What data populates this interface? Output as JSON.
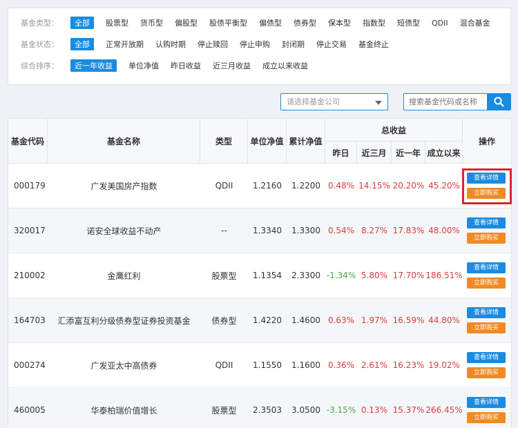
{
  "filters": {
    "type": {
      "label": "基金类型：",
      "options": [
        "全部",
        "股票型",
        "货币型",
        "偏股型",
        "股债平衡型",
        "偏债型",
        "债券型",
        "保本型",
        "指数型",
        "短债型",
        "QDII",
        "混合基金"
      ]
    },
    "status": {
      "label": "基金状态：",
      "options": [
        "全部",
        "正常开放期",
        "认购时期",
        "停止赎回",
        "停止申购",
        "封闭期",
        "停止交易",
        "基金终止"
      ]
    },
    "sort": {
      "label": "综合排序：",
      "options": [
        "近一年收益",
        "单位净值",
        "昨日收益",
        "近三月收益",
        "成立以来收益"
      ]
    }
  },
  "search": {
    "company_placeholder": "请选择基金公司",
    "keyword_placeholder": "搜索基金代码或名称"
  },
  "table": {
    "headers": {
      "code": "基金代码",
      "name": "基金名称",
      "type": "类型",
      "nav": "单位净值",
      "acc_nav": "累计净值",
      "total_return": "总收益",
      "yesterday": "昨日",
      "three_month": "近三月",
      "one_year": "近一年",
      "since_inception": "成立以来",
      "actions": "操作"
    },
    "rows": [
      {
        "code": "000179",
        "name": "广发美国房产指数",
        "type": "QDII",
        "nav": "1.2160",
        "acc_nav": "1.2200",
        "yesterday": "0.48%",
        "three_month": "14.15%",
        "one_year": "20.20%",
        "since_inception": "45.20%"
      },
      {
        "code": "320017",
        "name": "诺安全球收益不动产",
        "type": "--",
        "nav": "1.3340",
        "acc_nav": "1.3300",
        "yesterday": "0.54%",
        "three_month": "8.27%",
        "one_year": "17.83%",
        "since_inception": "48.00%"
      },
      {
        "code": "210002",
        "name": "金鹰红利",
        "type": "股票型",
        "nav": "1.1354",
        "acc_nav": "2.3300",
        "yesterday": "-1.34%",
        "three_month": "5.80%",
        "one_year": "17.70%",
        "since_inception": "186.51%"
      },
      {
        "code": "164703",
        "name": "汇添富互利分级债券型证券投资基金",
        "type": "债券型",
        "nav": "1.4220",
        "acc_nav": "1.4600",
        "yesterday": "0.63%",
        "three_month": "1.97%",
        "one_year": "16.59%",
        "since_inception": "44.80%"
      },
      {
        "code": "000274",
        "name": "广发亚太中高债券",
        "type": "QDII",
        "nav": "1.1550",
        "acc_nav": "1.1600",
        "yesterday": "0.36%",
        "three_month": "2.61%",
        "one_year": "16.23%",
        "since_inception": "19.02%"
      },
      {
        "code": "460005",
        "name": "华泰柏瑞价值增长",
        "type": "股票型",
        "nav": "2.3503",
        "acc_nav": "3.0500",
        "yesterday": "-3.15%",
        "three_month": "0.13%",
        "one_year": "15.37%",
        "since_inception": "266.45%"
      }
    ],
    "detail_label": "查看详情",
    "buy_label": "立即购买"
  },
  "colors": {
    "accent": "#1a8be0",
    "buy": "#f08a24",
    "up": "#e03a3a",
    "down": "#4aa84a",
    "highlight": "#d9262c"
  }
}
